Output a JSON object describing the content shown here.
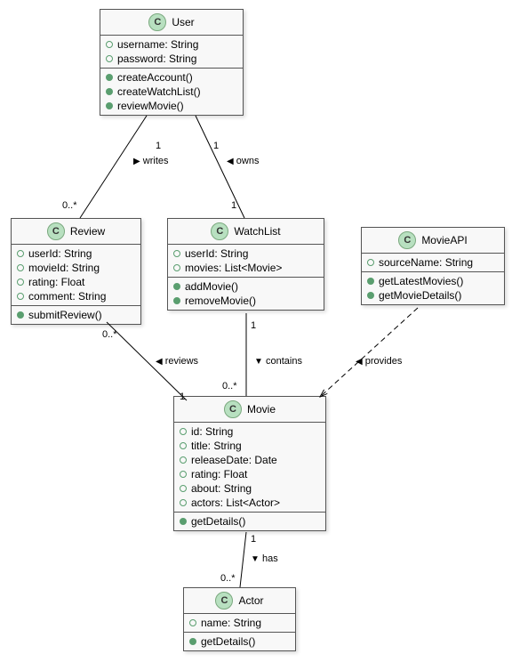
{
  "classes": {
    "user": {
      "name": "User",
      "attrs": [
        "username: String",
        "password: String"
      ],
      "methods": [
        "createAccount()",
        "createWatchList()",
        "reviewMovie()"
      ]
    },
    "review": {
      "name": "Review",
      "attrs": [
        "userId: String",
        "movieId: String",
        "rating: Float",
        "comment: String"
      ],
      "methods": [
        "submitReview()"
      ]
    },
    "watchlist": {
      "name": "WatchList",
      "attrs": [
        "userId: String",
        "movies: List<Movie>"
      ],
      "methods": [
        "addMovie()",
        "removeMovie()"
      ]
    },
    "movieapi": {
      "name": "MovieAPI",
      "attrs": [
        "sourceName: String"
      ],
      "methods": [
        "getLatestMovies()",
        "getMovieDetails()"
      ]
    },
    "movie": {
      "name": "Movie",
      "attrs": [
        "id: String",
        "title: String",
        "releaseDate: Date",
        "rating: Float",
        "about: String",
        "actors: List<Actor>"
      ],
      "methods": [
        "getDetails()"
      ]
    },
    "actor": {
      "name": "Actor",
      "attrs": [
        "name: String"
      ],
      "methods": [
        "getDetails()"
      ]
    }
  },
  "relations": {
    "writes": {
      "label": "writes",
      "m1": "1",
      "m2": "0..*"
    },
    "owns": {
      "label": "owns",
      "m1": "1",
      "m2": "1"
    },
    "reviews": {
      "label": "reviews",
      "m1": "0..*",
      "m2": "1"
    },
    "contains": {
      "label": "contains",
      "m1": "1",
      "m2": "0..*"
    },
    "provides": {
      "label": "provides"
    },
    "has": {
      "label": "has",
      "m1": "1",
      "m2": "0..*"
    }
  },
  "icon_letter": "C"
}
